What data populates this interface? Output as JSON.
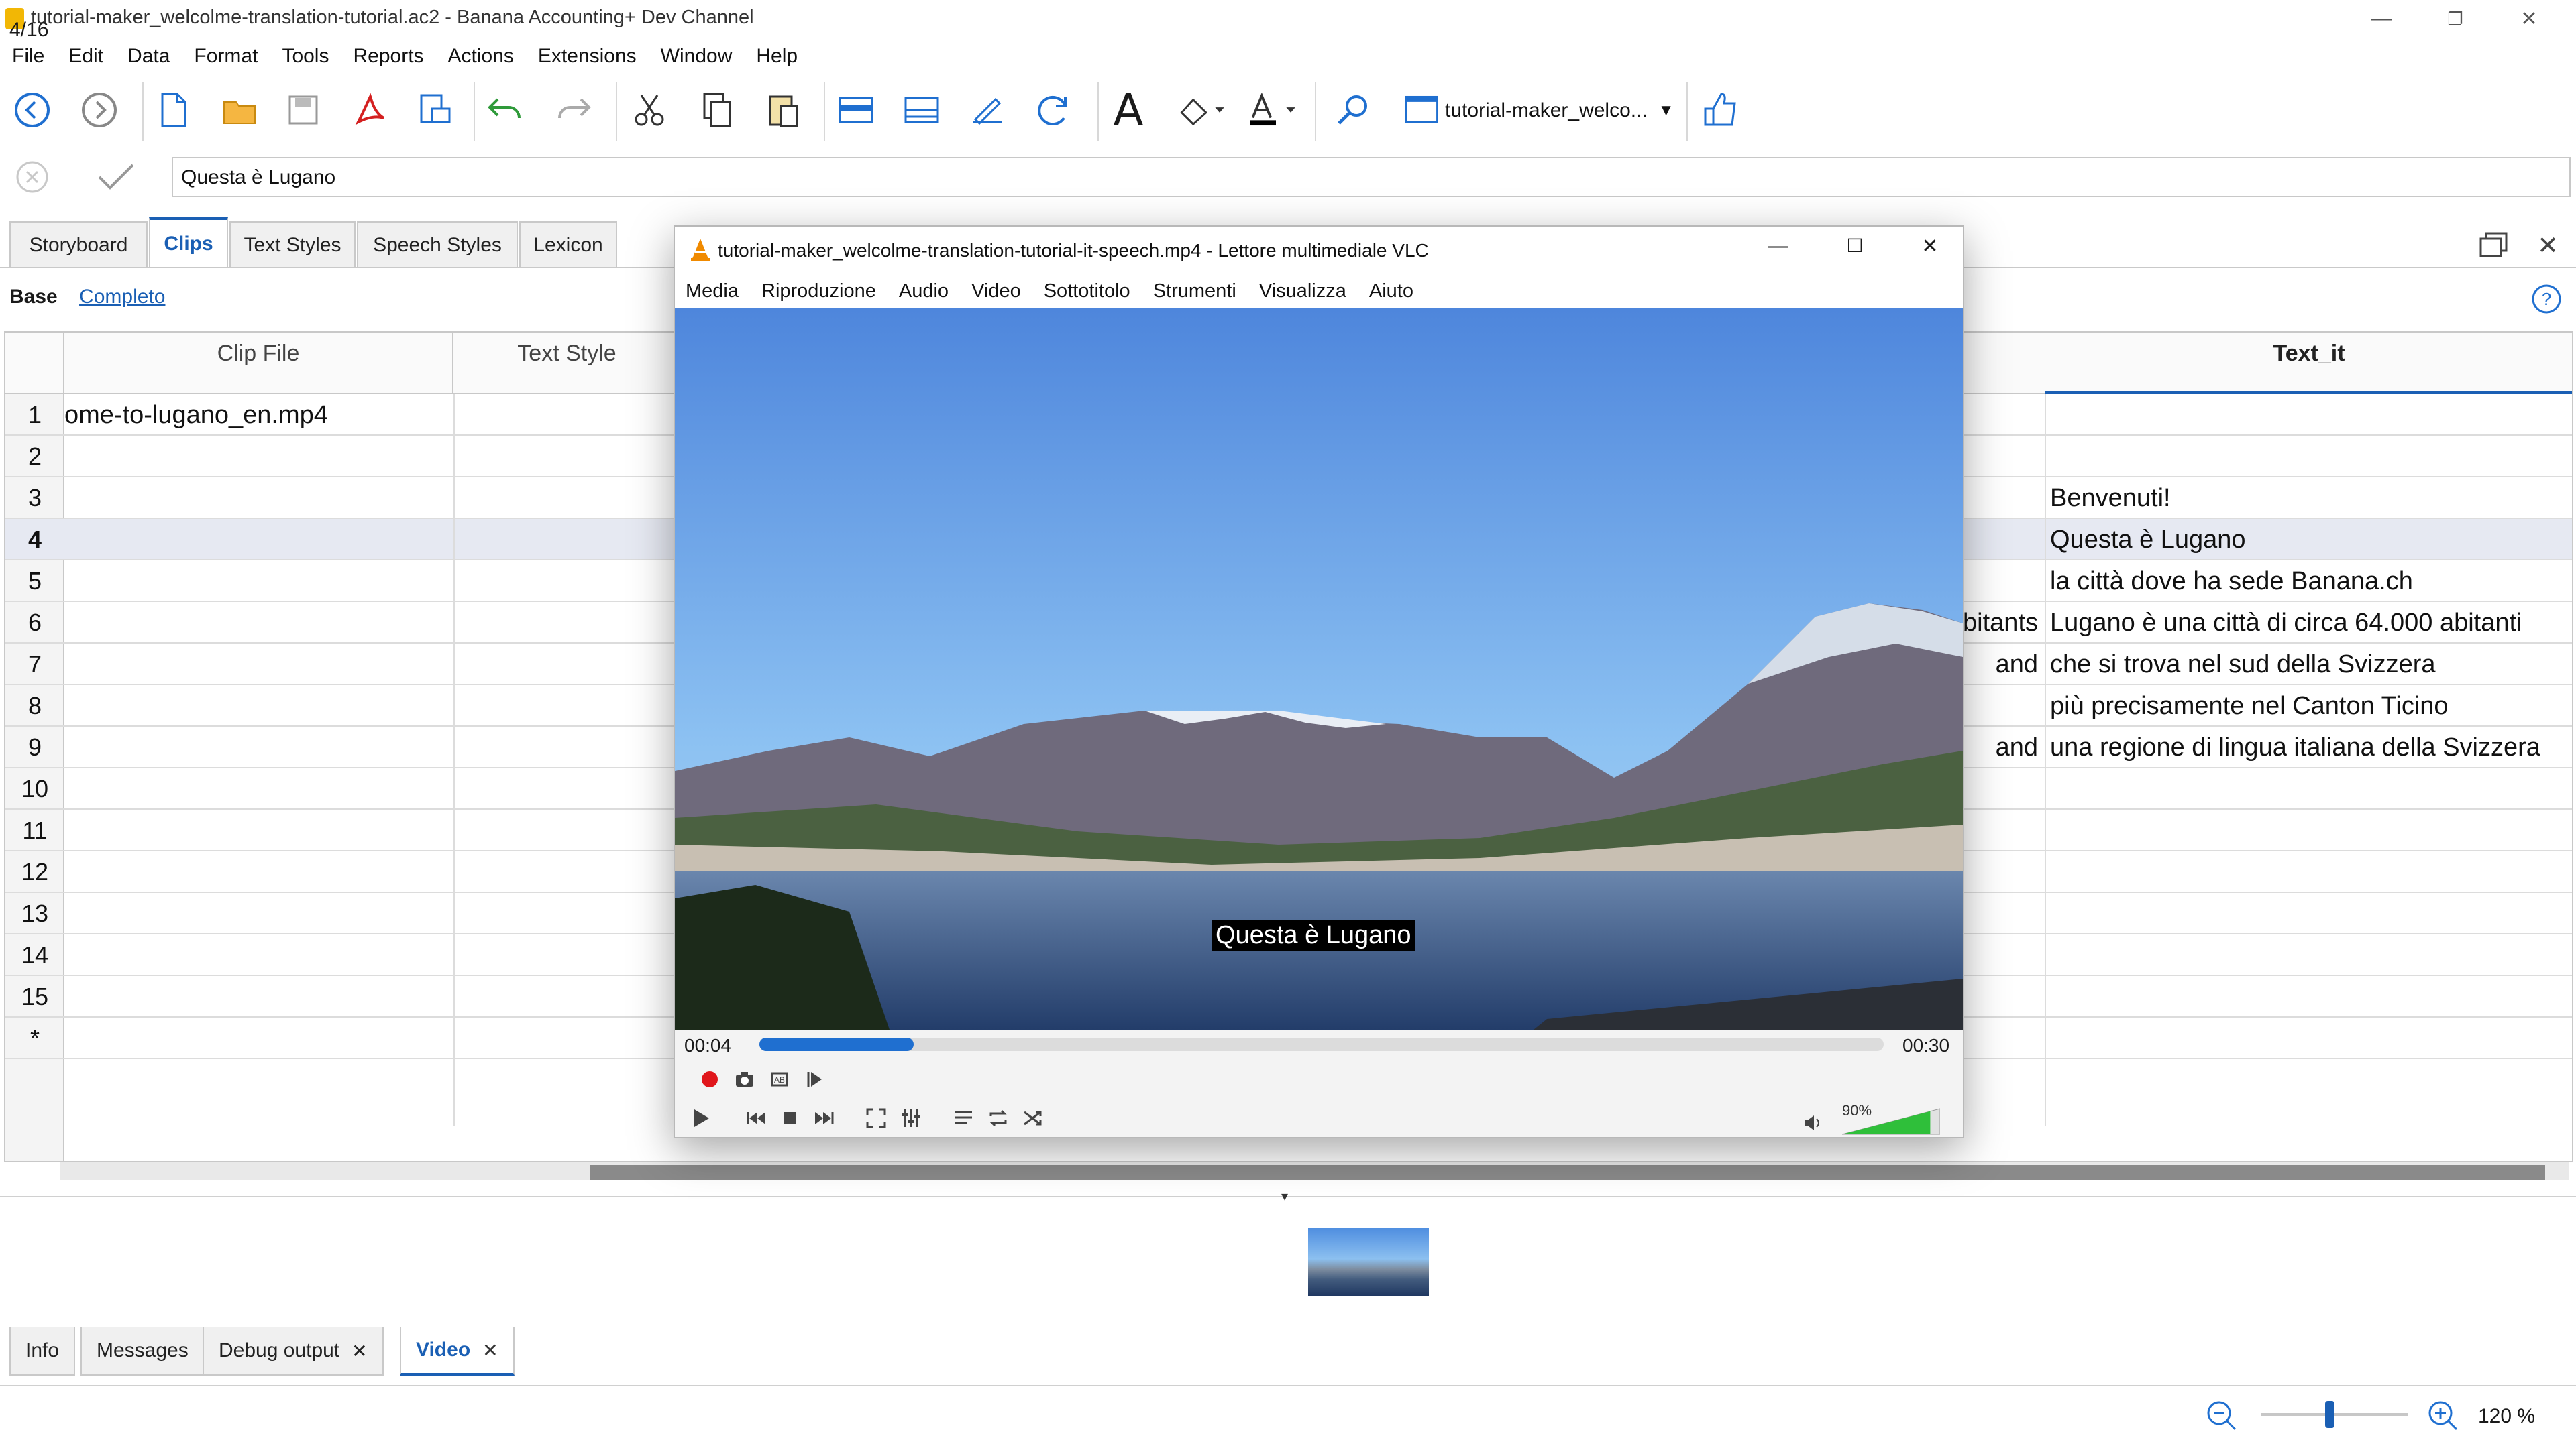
{
  "window": {
    "title": "tutorial-maker_welcolme-translation-tutorial.ac2 - Banana Accounting+ Dev Channel",
    "minimize": "—",
    "maximize": "❐",
    "close": "✕"
  },
  "menu": [
    "File",
    "Edit",
    "Data",
    "Format",
    "Tools",
    "Reports",
    "Actions",
    "Extensions",
    "Window",
    "Help"
  ],
  "toolbar": {
    "document_name": "tutorial-maker_welco...",
    "font_glyph": "A"
  },
  "edit_row": {
    "cell_value": "Questa è Lugano"
  },
  "tabs": [
    {
      "label": "Storyboard",
      "active": false
    },
    {
      "label": "Clips",
      "active": true
    },
    {
      "label": "Text Styles",
      "active": false
    },
    {
      "label": "Speech Styles",
      "active": false
    },
    {
      "label": "Lexicon",
      "active": false
    }
  ],
  "views": {
    "base": "Base",
    "complete": "Completo"
  },
  "grid": {
    "columns": {
      "clip_file": "Clip File",
      "text_style": "Text Style",
      "text_it": "Text_it"
    },
    "rows": [
      {
        "n": "1",
        "clip": "ome-to-lugano_en.mp4",
        "mid": "",
        "text_it": ""
      },
      {
        "n": "2",
        "clip": "",
        "mid": "",
        "text_it": ""
      },
      {
        "n": "3",
        "clip": "",
        "mid": "",
        "text_it": "Benvenuti!"
      },
      {
        "n": "4",
        "clip": "",
        "mid": "",
        "text_it": "Questa è Lugano"
      },
      {
        "n": "5",
        "clip": "",
        "mid": "",
        "text_it": "la città dove ha sede Banana.ch"
      },
      {
        "n": "6",
        "clip": "",
        "mid": "bitants",
        "text_it": "Lugano è una città di circa 64.000 abitanti"
      },
      {
        "n": "7",
        "clip": "",
        "mid": "and",
        "text_it": "che si trova nel sud della Svizzera"
      },
      {
        "n": "8",
        "clip": "",
        "mid": "",
        "text_it": "più precisamente nel Canton Ticino"
      },
      {
        "n": "9",
        "clip": "",
        "mid": "and",
        "text_it": "una regione di lingua italiana della Svizzera"
      },
      {
        "n": "10",
        "clip": "",
        "mid": "",
        "text_it": ""
      },
      {
        "n": "11",
        "clip": "",
        "mid": "",
        "text_it": ""
      },
      {
        "n": "12",
        "clip": "",
        "mid": "",
        "text_it": ""
      },
      {
        "n": "13",
        "clip": "",
        "mid": "",
        "text_it": ""
      },
      {
        "n": "14",
        "clip": "",
        "mid": "",
        "text_it": ""
      },
      {
        "n": "15",
        "clip": "",
        "mid": "",
        "text_it": ""
      },
      {
        "n": "*",
        "clip": "",
        "mid": "",
        "text_it": ""
      }
    ],
    "current_row": "4"
  },
  "bottom_tabs": [
    {
      "label": "Info",
      "closable": false,
      "active": false
    },
    {
      "label": "Messages",
      "closable": false,
      "active": false
    },
    {
      "label": "Debug output",
      "closable": true,
      "active": false
    },
    {
      "label": "Video",
      "closable": true,
      "active": true
    }
  ],
  "status": {
    "position": "4/16",
    "zoom": "120 %",
    "zoom_level": 0.47
  },
  "vlc": {
    "title": "tutorial-maker_welcolme-translation-tutorial-it-speech.mp4 - Lettore multimediale VLC",
    "menu": [
      "Media",
      "Riproduzione",
      "Audio",
      "Video",
      "Sottotitolo",
      "Strumenti",
      "Visualizza",
      "Aiuto"
    ],
    "subtitle": "Questa è Lugano",
    "time_current": "00:04",
    "time_total": "00:30",
    "progress": 0.137,
    "volume": "90%",
    "volume_level": 0.9
  },
  "colors": {
    "accent": "#1a5fb4",
    "seek": "#1f6fd0",
    "record": "#e0161b",
    "volume": "#2fbf3a"
  }
}
